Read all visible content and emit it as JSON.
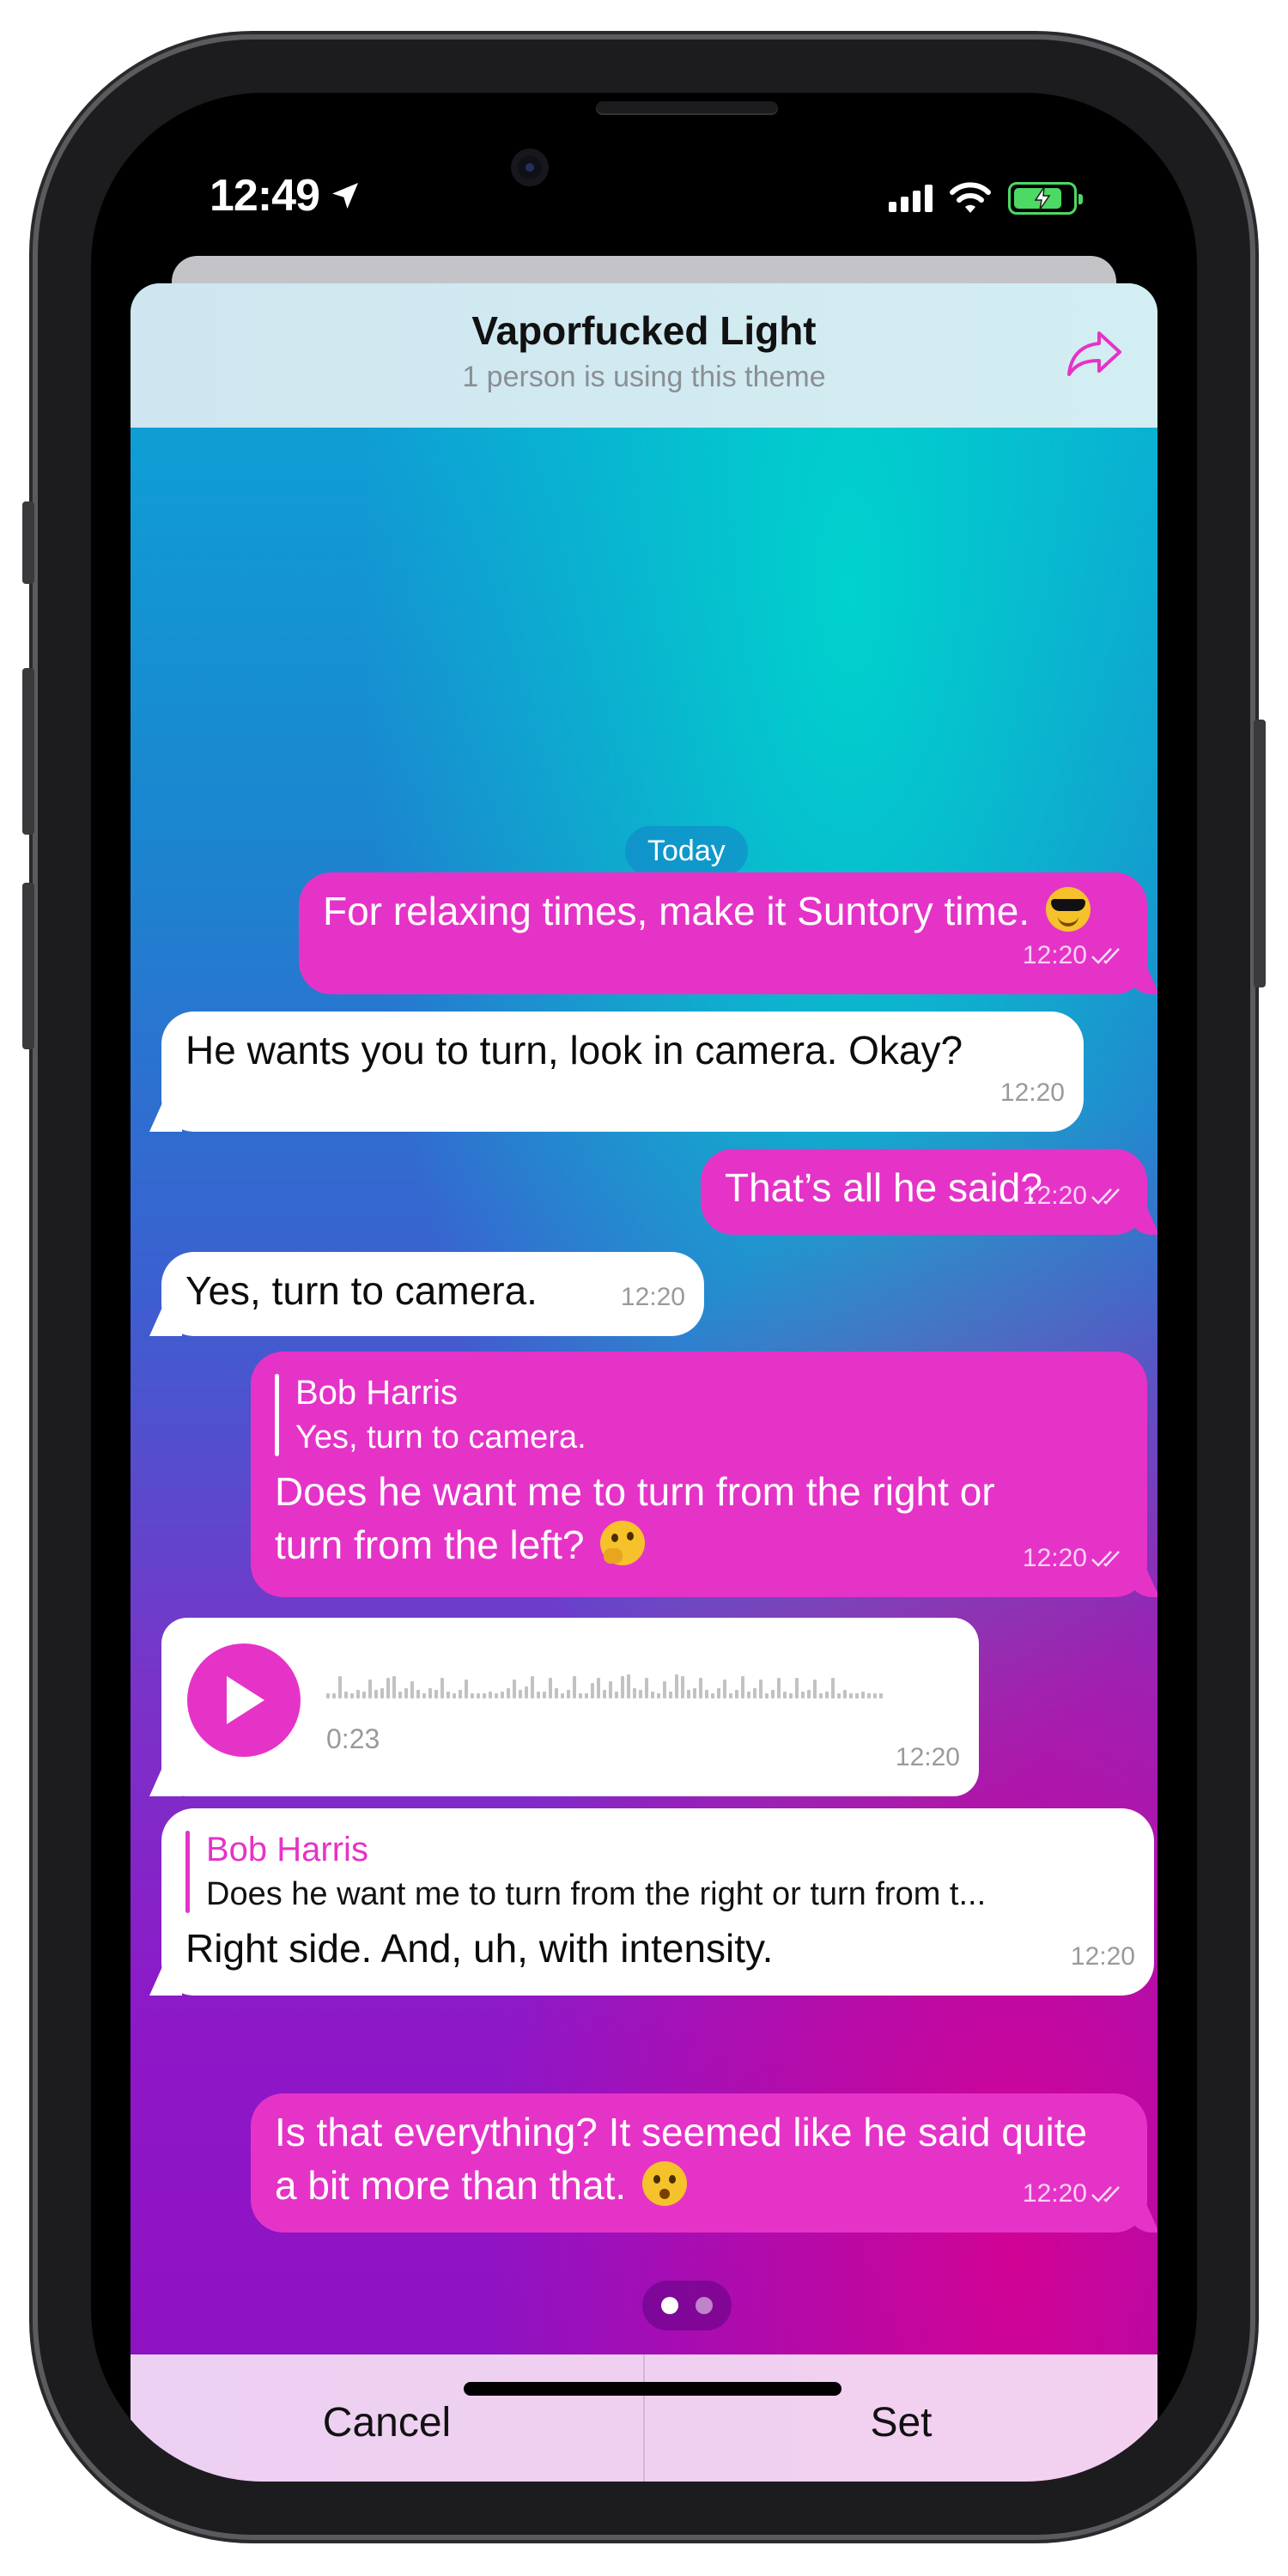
{
  "status_bar": {
    "time": "12:49"
  },
  "sheet": {
    "title": "Vaporfucked Light",
    "subtitle": "1 person is using this theme"
  },
  "chat": {
    "date_label": "Today",
    "messages": [
      {
        "direction": "out",
        "text": "For relaxing times, make it Suntory time.",
        "emoji": "smiling-face-with-sunglasses",
        "time": "12:20"
      },
      {
        "direction": "in",
        "text": "He wants you to turn, look in camera. Okay?",
        "time": "12:20"
      },
      {
        "direction": "out",
        "text": "That’s all he said?",
        "time": "12:20"
      },
      {
        "direction": "in",
        "text": "Yes, turn to camera.",
        "time": "12:20"
      },
      {
        "direction": "out",
        "reply_name": "Bob Harris",
        "reply_text": "Yes, turn to camera.",
        "text": "Does he want me to turn from the right or turn from the left?",
        "emoji": "thinking-face",
        "time": "12:20"
      },
      {
        "direction": "in",
        "type": "voice",
        "duration": "0:23",
        "time": "12:20"
      },
      {
        "direction": "in",
        "reply_name": "Bob Harris",
        "reply_text": "Does he want me to turn from the right or turn from t...",
        "text": "Right side. And, uh, with intensity.",
        "time": "12:20"
      },
      {
        "direction": "out",
        "text": "Is that everything? It seemed like he said quite a bit more than that.",
        "emoji": "hushed-face",
        "time": "12:20"
      }
    ]
  },
  "pager": {
    "pages": 2,
    "active": 1
  },
  "actions": {
    "cancel_label": "Cancel",
    "set_label": "Set"
  },
  "colors": {
    "accent": "#e533c8",
    "incoming_bubble": "#ffffff",
    "battery": "#4cd964"
  }
}
